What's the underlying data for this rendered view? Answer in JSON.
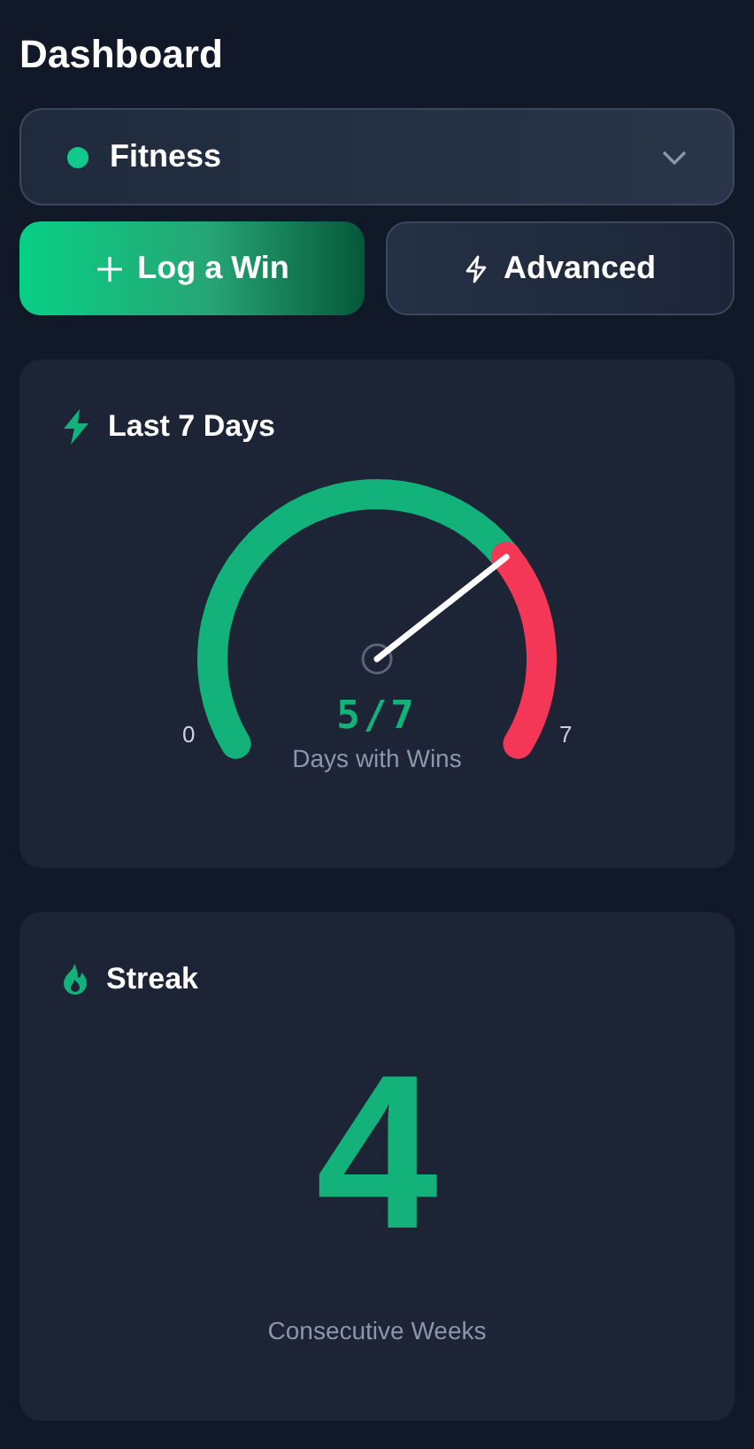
{
  "title": "Dashboard",
  "category_select": {
    "value": "Fitness",
    "color": "#10c98a"
  },
  "actions": [
    {
      "kind": "primary",
      "label": "Log a Win"
    },
    {
      "kind": "secondary",
      "label": "Advanced"
    }
  ],
  "week_card": {
    "title": "Last 7 Days",
    "gauge": {
      "min_label": "0",
      "max_label": "7",
      "value": "5/7",
      "caption": "Days with Wins"
    }
  },
  "streak_card": {
    "title": "Streak",
    "value": "4",
    "caption": "Consecutive Weeks"
  }
}
